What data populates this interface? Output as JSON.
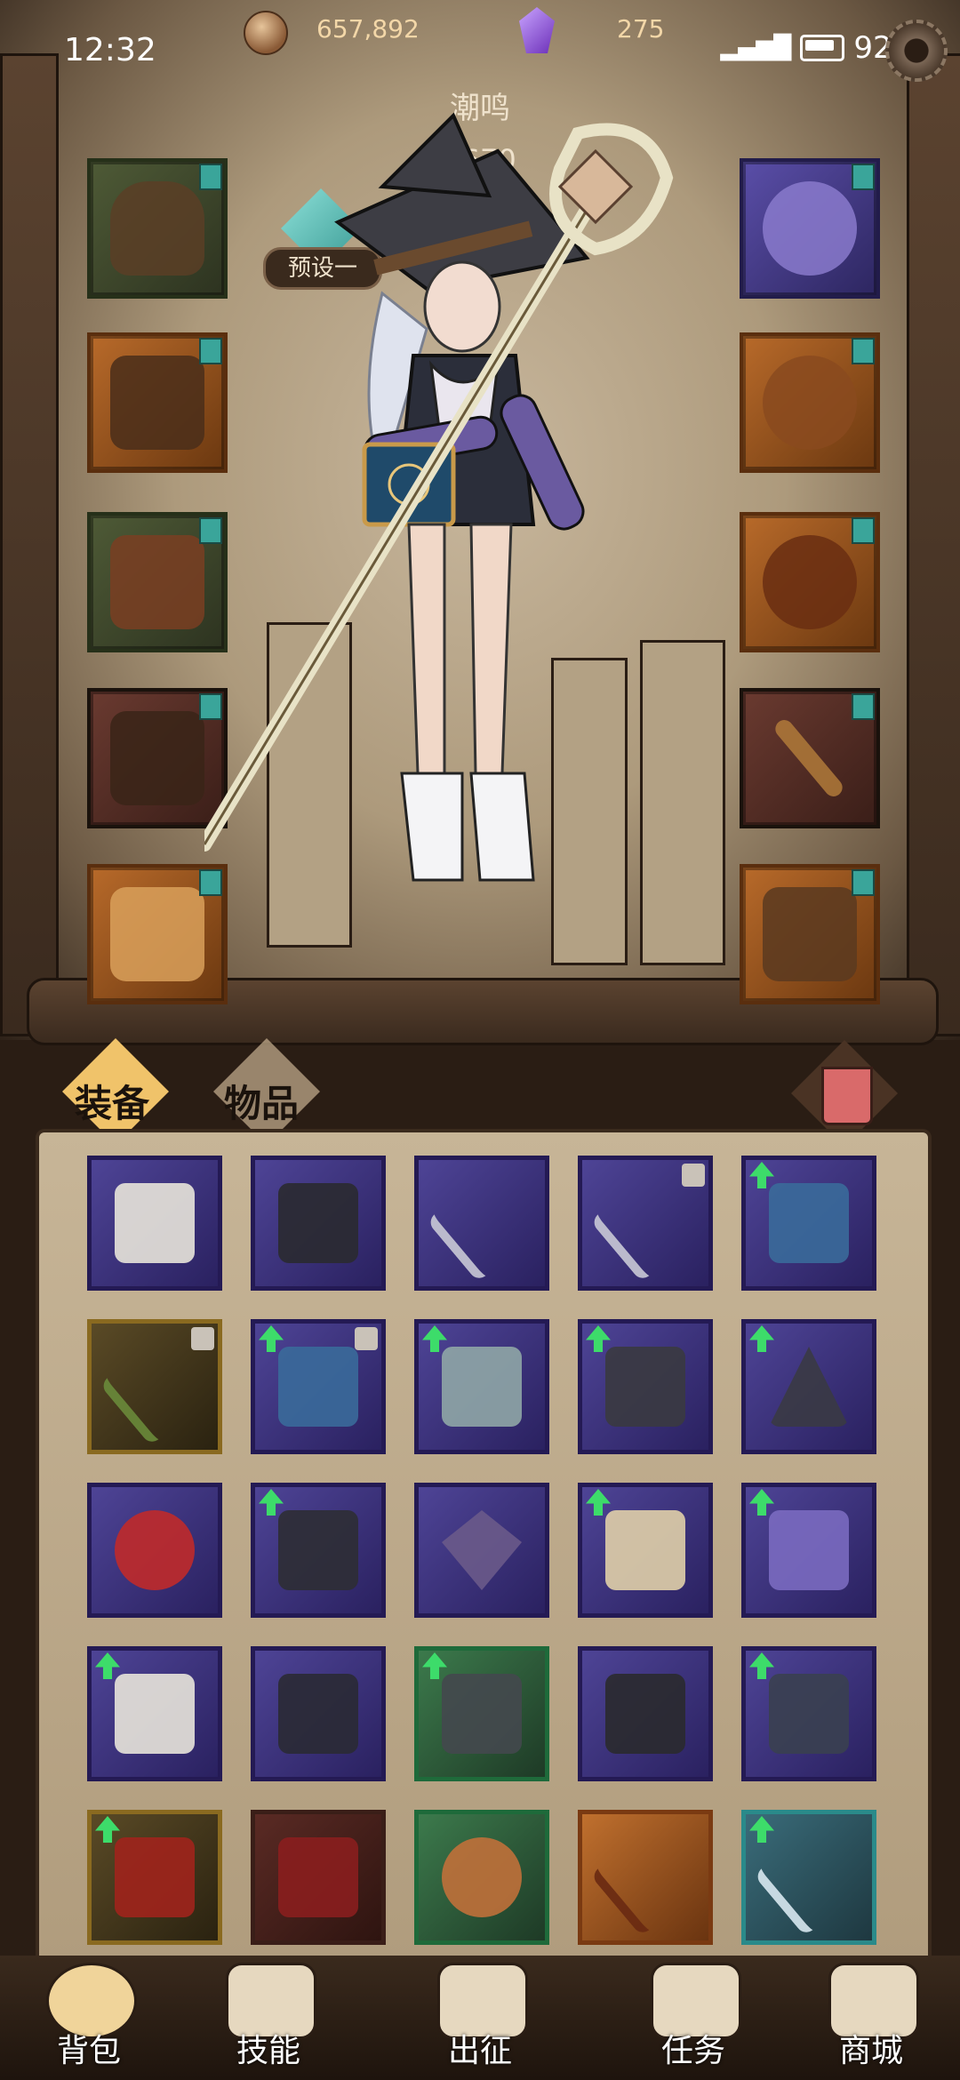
{
  "status_bar": {
    "time": "12:32",
    "coins": "657,892",
    "crystals": "275",
    "battery": "92%"
  },
  "character": {
    "name": "潮鸣",
    "power": "1670",
    "preset_label": "预设一"
  },
  "tabs": {
    "equipment": "装备",
    "items": "物品"
  },
  "nav": {
    "bag": "背包",
    "skills": "技能",
    "expedition": "出征",
    "quests": "任务",
    "shop": "商城"
  },
  "colors": {
    "accent_gold": "#f0c36a",
    "upgrade_arrow": "#3ddc6a",
    "rarity_purple": "#4e4496",
    "rarity_orange": "#c0702e",
    "rarity_green": "#3c7a4c"
  }
}
